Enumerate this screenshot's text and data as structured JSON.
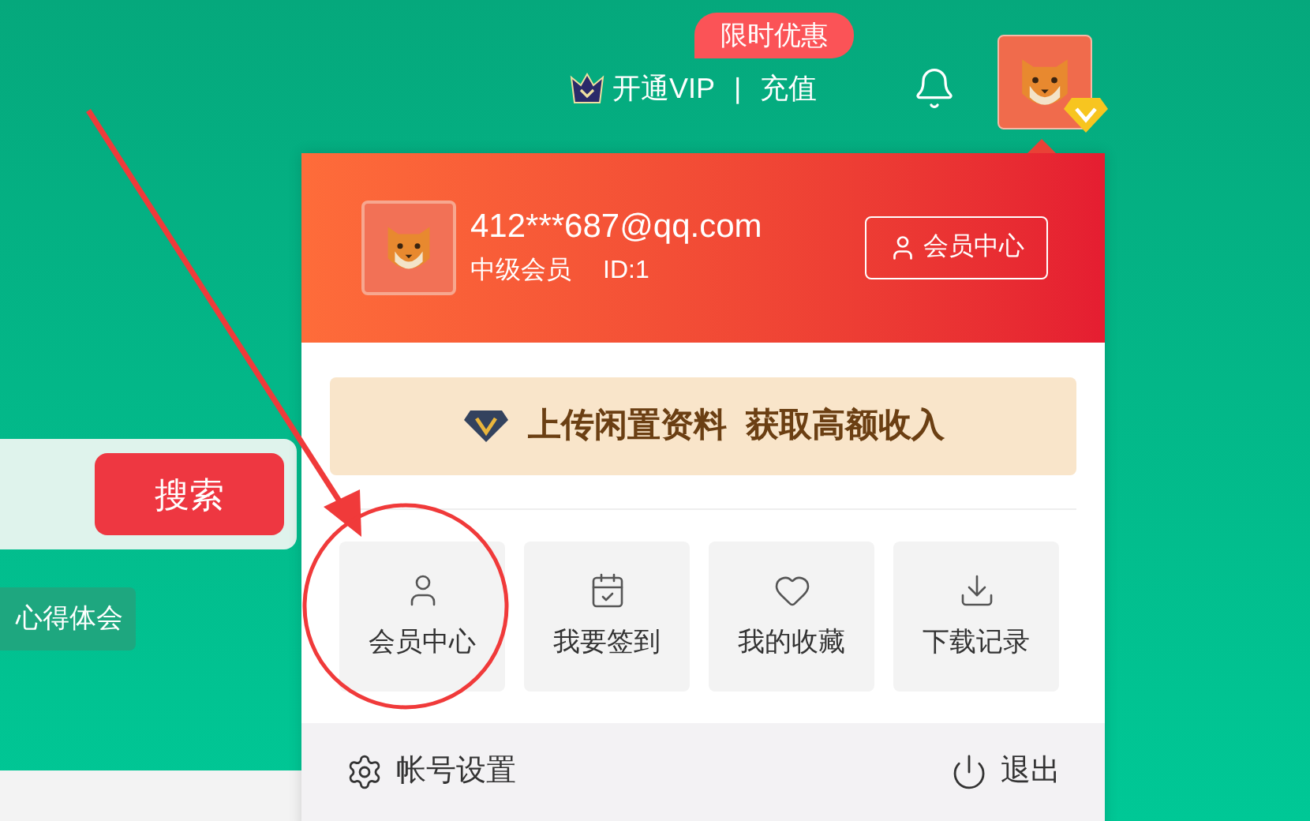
{
  "top_bar": {
    "promo_badge": "限时优惠",
    "vip_link": "开通VIP",
    "separator": "|",
    "recharge_link": "充值"
  },
  "search": {
    "button": "搜索"
  },
  "tag": "心得体会",
  "account_menu": {
    "email": "412***687@qq.com",
    "level": "中级会员",
    "id": "ID:1",
    "member_center_button": "会员中心",
    "banner": [
      "上传闲置资料",
      "获取高额收入"
    ],
    "tiles": [
      {
        "label": "会员中心",
        "kind": "user"
      },
      {
        "label": "我要签到",
        "kind": "checkin"
      },
      {
        "label": "我的收藏",
        "kind": "favorite"
      },
      {
        "label": "下载记录",
        "kind": "download"
      }
    ],
    "footer": {
      "settings": "帐号设置",
      "logout": "退出"
    }
  }
}
